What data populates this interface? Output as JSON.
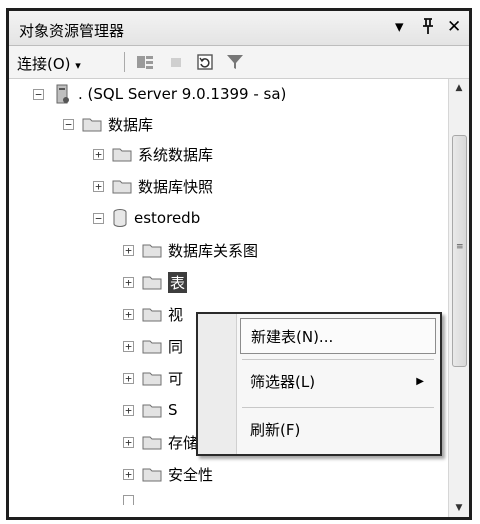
{
  "panel": {
    "title": "对象资源管理器",
    "dropdown_icon": "▾",
    "pin_icon": "ꟷ",
    "close_icon": "✕"
  },
  "toolbar": {
    "connect_label": "连接(O)",
    "connect_arrow": "▾"
  },
  "tree": {
    "server": ". (SQL Server 9.0.1399 - sa)",
    "databases": "数据库",
    "system_databases": "系统数据库",
    "database_snapshots": "数据库快照",
    "estoredb": "estoredb",
    "diagrams": "数据库关系图",
    "tables": "表",
    "views_partial": "视",
    "synonyms_partial": "同",
    "programmability_partial": "可",
    "service_broker_partial": "S",
    "storage": "存储",
    "security": "安全性"
  },
  "context_menu": {
    "new_table": "新建表(N)...",
    "filter": "筛选器(L)",
    "filter_arrow": "▶",
    "refresh": "刷新(F)"
  },
  "symbols": {
    "expanded": "−",
    "collapsed": "+"
  }
}
